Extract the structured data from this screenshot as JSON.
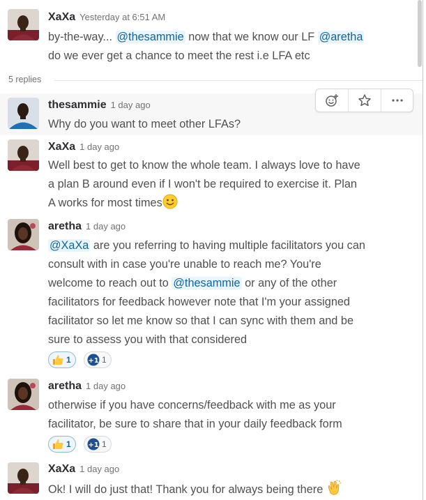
{
  "thread": {
    "parent": {
      "author": "XaXa",
      "time": "Yesterday at 6:51 AM",
      "lines": [
        {
          "pre": "by-the-way... ",
          "mention1": "@thesammie",
          "mid": " now that we know our LF ",
          "mention2": "@aretha"
        },
        {
          "text": "do we ever get a chance to meet the rest i.e LFA etc"
        }
      ]
    },
    "replies_label": "5 replies",
    "message_actions": {
      "add_reaction_icon": "add-reaction-icon",
      "star_icon": "star-icon",
      "more_icon": "more-actions-icon"
    },
    "replies": [
      {
        "author": "thesammie",
        "time": "1 day ago",
        "lines": [
          "Why do you want to meet other LFAs?"
        ]
      },
      {
        "author": "XaXa",
        "time": "1 day ago",
        "lines": [
          "Well best to get to know the whole team. I always love to have",
          "a plan B around even if  I won't be required to exercise it. Plan",
          "A works for most times"
        ],
        "emoji": "smile-emoji"
      },
      {
        "author": "aretha",
        "time": "1 day ago",
        "line1_mention": "@XaXa",
        "line1_rest": " are you referring to having multiple facilitators you can",
        "line2": "consult with in case you're unable to reach me? You're",
        "line3_pre": "welcome to reach out to ",
        "line3_mention": "@thesammie",
        "line3_rest": " or any of the other",
        "line4": "facilitators for feedback however note that I'm your assigned",
        "line5": "facilitator so let me know so that I can sync with them and be",
        "line6": "sure to assess you with that considered",
        "reactions": [
          {
            "emoji": "thumbs-up-emoji",
            "count": "1"
          },
          {
            "emoji": "plus-one-emoji",
            "count": "1"
          }
        ]
      },
      {
        "author": "aretha",
        "time": "1 day ago",
        "lines": [
          "otherwise if you have concerns/feedback with me as your",
          "facilitator, be sure to share that in your daily feedback form"
        ],
        "reactions": [
          {
            "emoji": "thumbs-up-emoji",
            "count": "1"
          },
          {
            "emoji": "plus-one-emoji",
            "count": "1"
          }
        ]
      },
      {
        "author": "XaXa",
        "time": "1 day ago",
        "lines": [
          "Ok! I will do just that! Thank you for always being there "
        ],
        "emoji": "clapping-hands-emoji"
      }
    ]
  },
  "colors": {
    "mention_bg": "#e8f5fa",
    "mention_text": "#1264a3",
    "reaction_active_border": "#8dbbdc"
  }
}
